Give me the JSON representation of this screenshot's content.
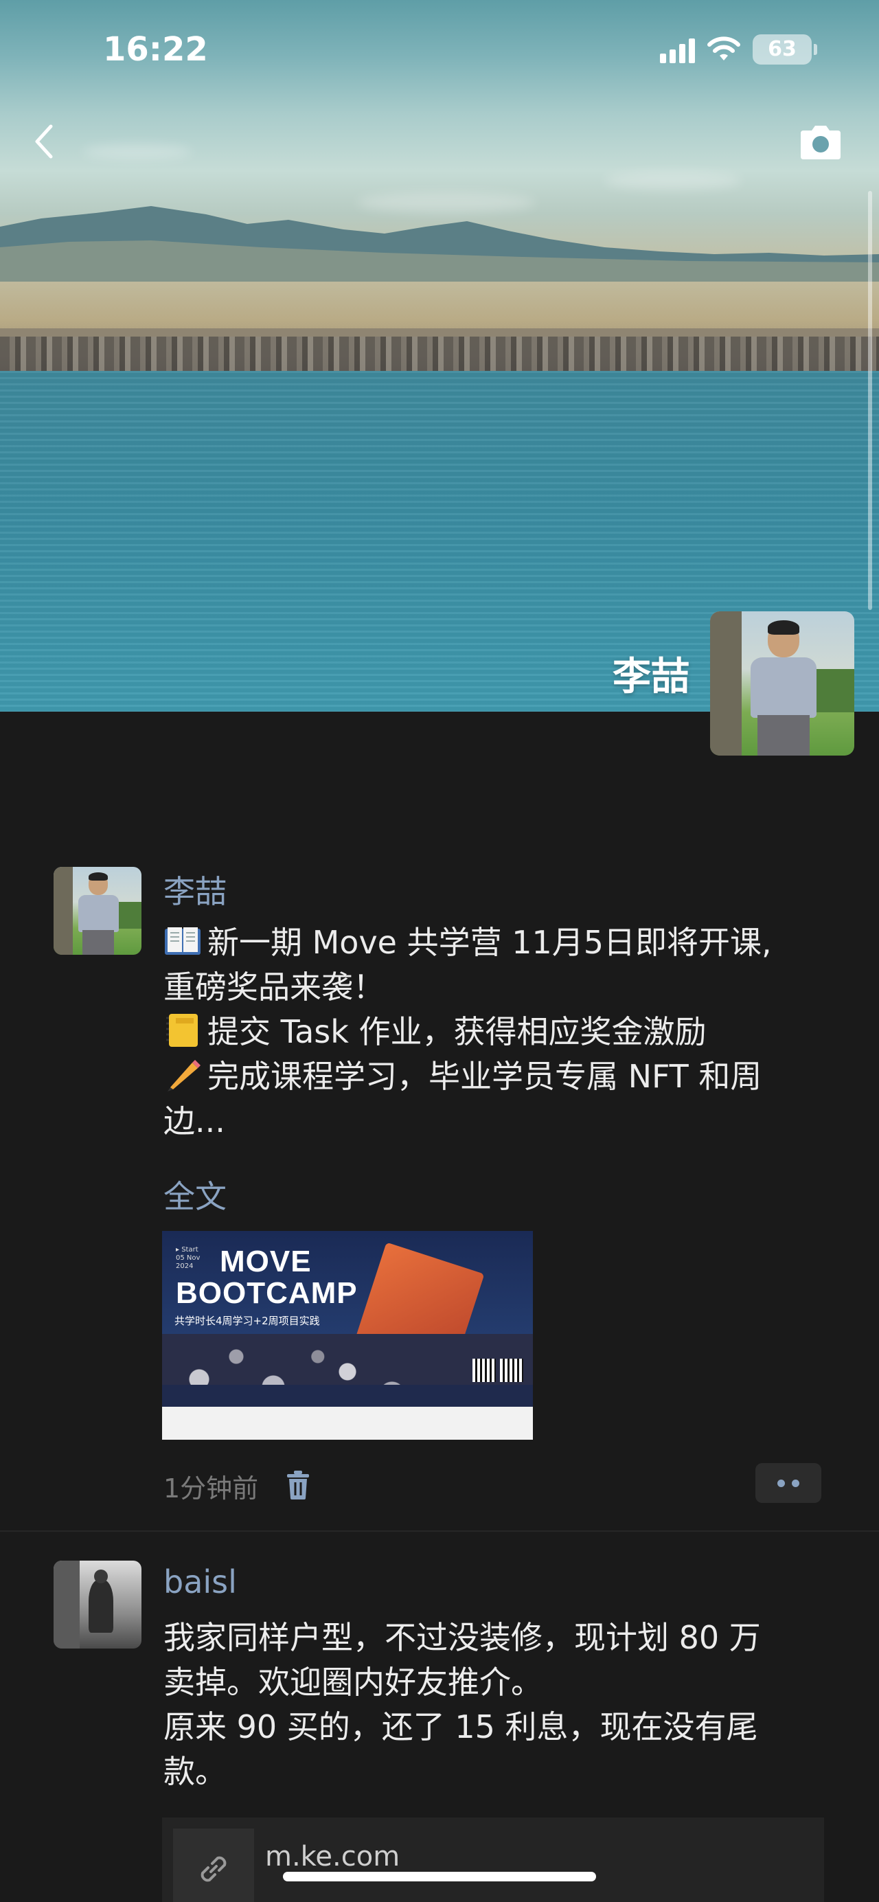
{
  "status_bar": {
    "time": "16:22",
    "battery": "63"
  },
  "profile": {
    "name": "李喆"
  },
  "posts": [
    {
      "author": "李喆",
      "lines": [
        {
          "emoji": "open-book-emoji",
          "text": "新一期 Move 共学营 11月5日即将开课,"
        },
        {
          "emoji": "",
          "text": "重磅奖品来袭！"
        },
        {
          "emoji": "notebook-emoji",
          "text": "提交 Task 作业，获得相应奖金激励"
        },
        {
          "emoji": "pencil-emoji",
          "text": "完成课程学习，毕业学员专属 NFT 和周"
        },
        {
          "emoji": "",
          "text": "边..."
        }
      ],
      "full_text_label": "全文",
      "image": {
        "date_line1": "▸ Start",
        "date_line2": "05 Nov",
        "date_line3": "2024",
        "title_line1": "MOVE",
        "title_line2": "BOOTCAMP",
        "subtitle": "共学时长4周学习+2周项目实践"
      },
      "time": "1分钟前"
    },
    {
      "author": "baisl",
      "lines": [
        {
          "emoji": "",
          "text": "我家同样户型，不过没装修，现计划 80 万"
        },
        {
          "emoji": "",
          "text": "卖掉。欢迎圈内好友推介。"
        },
        {
          "emoji": "",
          "text": "原来 90 买的，还了 15 利息，现在没有尾"
        },
        {
          "emoji": "",
          "text": "款。"
        }
      ],
      "link": {
        "icon": "link-icon",
        "text": "m.ke.com"
      }
    }
  ],
  "colors": {
    "background": "#1a1a1a",
    "author_link": "#8aa3c2",
    "body_text": "#ececec",
    "meta_text": "#7a7a7a"
  }
}
